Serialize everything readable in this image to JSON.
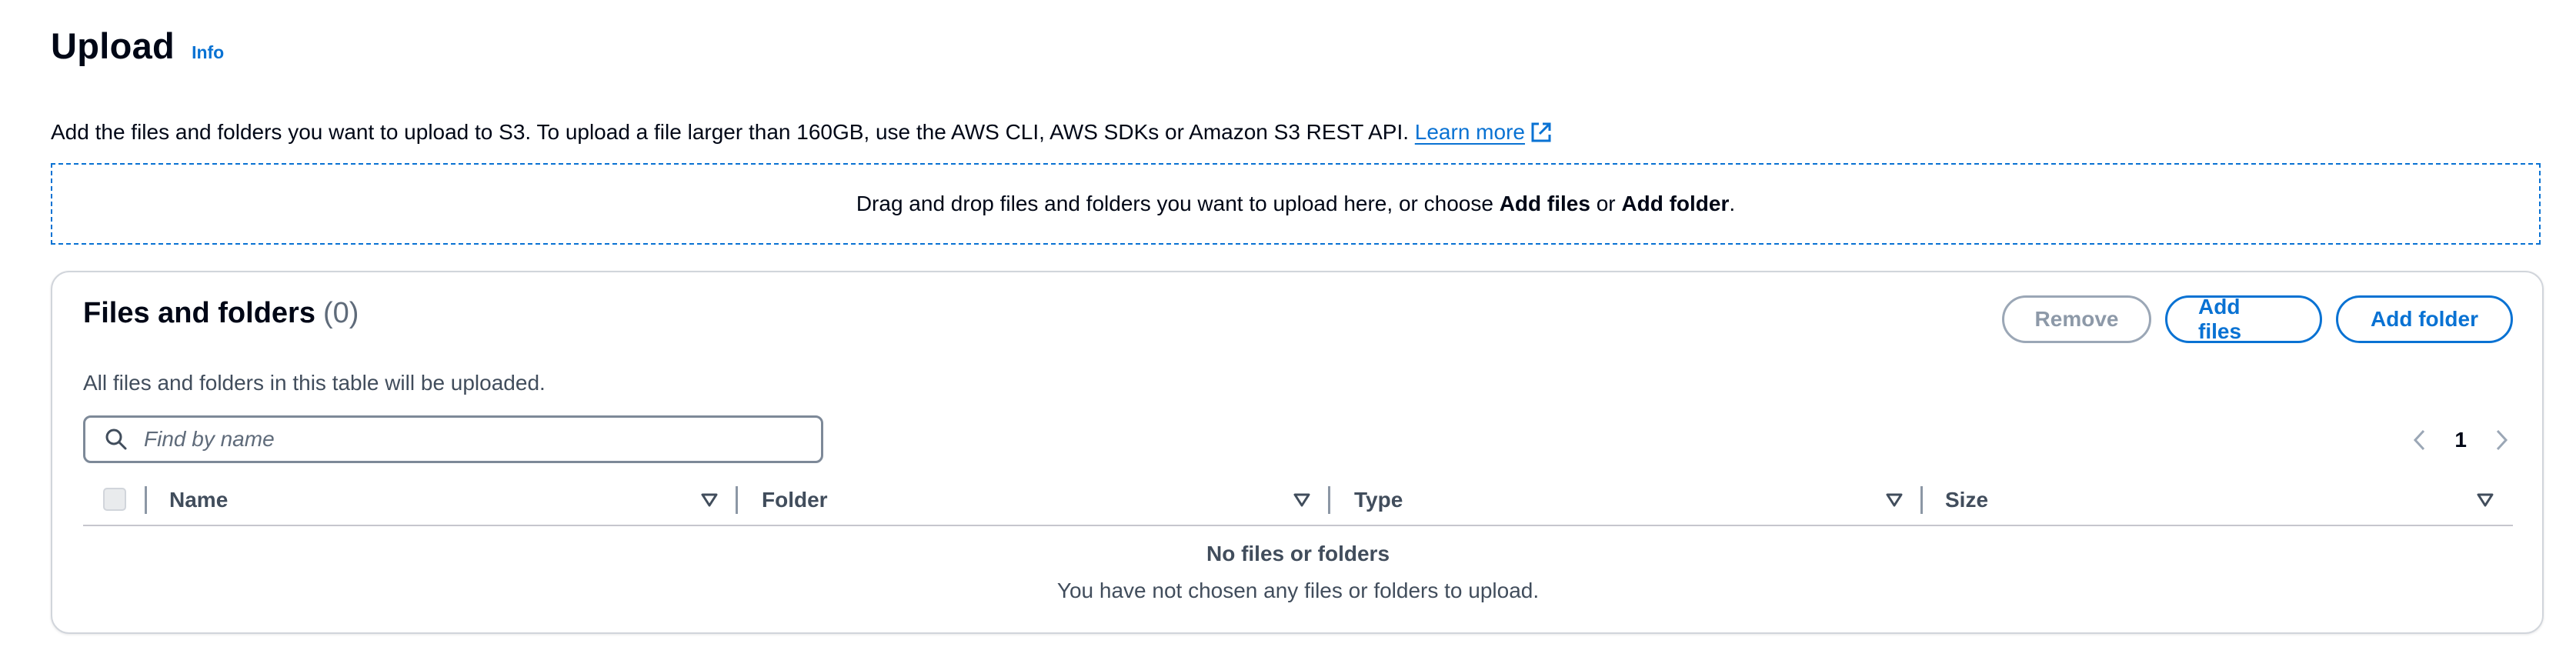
{
  "header": {
    "title": "Upload",
    "info_link": "Info",
    "description": "Add the files and folders you want to upload to S3. To upload a file larger than 160GB, use the AWS CLI, AWS SDKs or Amazon S3 REST API.",
    "learn_more": "Learn more",
    "learn_more_icon": "external-link-icon"
  },
  "dropzone": {
    "text_before": "Drag and drop files and folders you want to upload here, or choose",
    "add_files": "Add files",
    "or": "or",
    "add_folder": "Add folder",
    "period": "."
  },
  "files_panel": {
    "title": "Files and folders",
    "count": "(0)",
    "subtitle": "All files and folders in this table will be uploaded.",
    "buttons": {
      "remove": "Remove",
      "add_files": "Add files",
      "add_folder": "Add folder"
    },
    "search": {
      "placeholder": "Find by name",
      "value": "",
      "icon": "search-icon"
    },
    "pagination": {
      "current_page": "1",
      "prev_icon": "chevron-left-icon",
      "next_icon": "chevron-right-icon"
    },
    "columns": [
      "Name",
      "Folder",
      "Type",
      "Size"
    ],
    "empty": {
      "title": "No files or folders",
      "message": "You have not chosen any files or folders to upload."
    }
  },
  "colors": {
    "link": "#0972d3",
    "text": "#000716",
    "secondary_text": "#414d5c",
    "disabled": "#9ba7b6",
    "border": "#d1d5db"
  }
}
